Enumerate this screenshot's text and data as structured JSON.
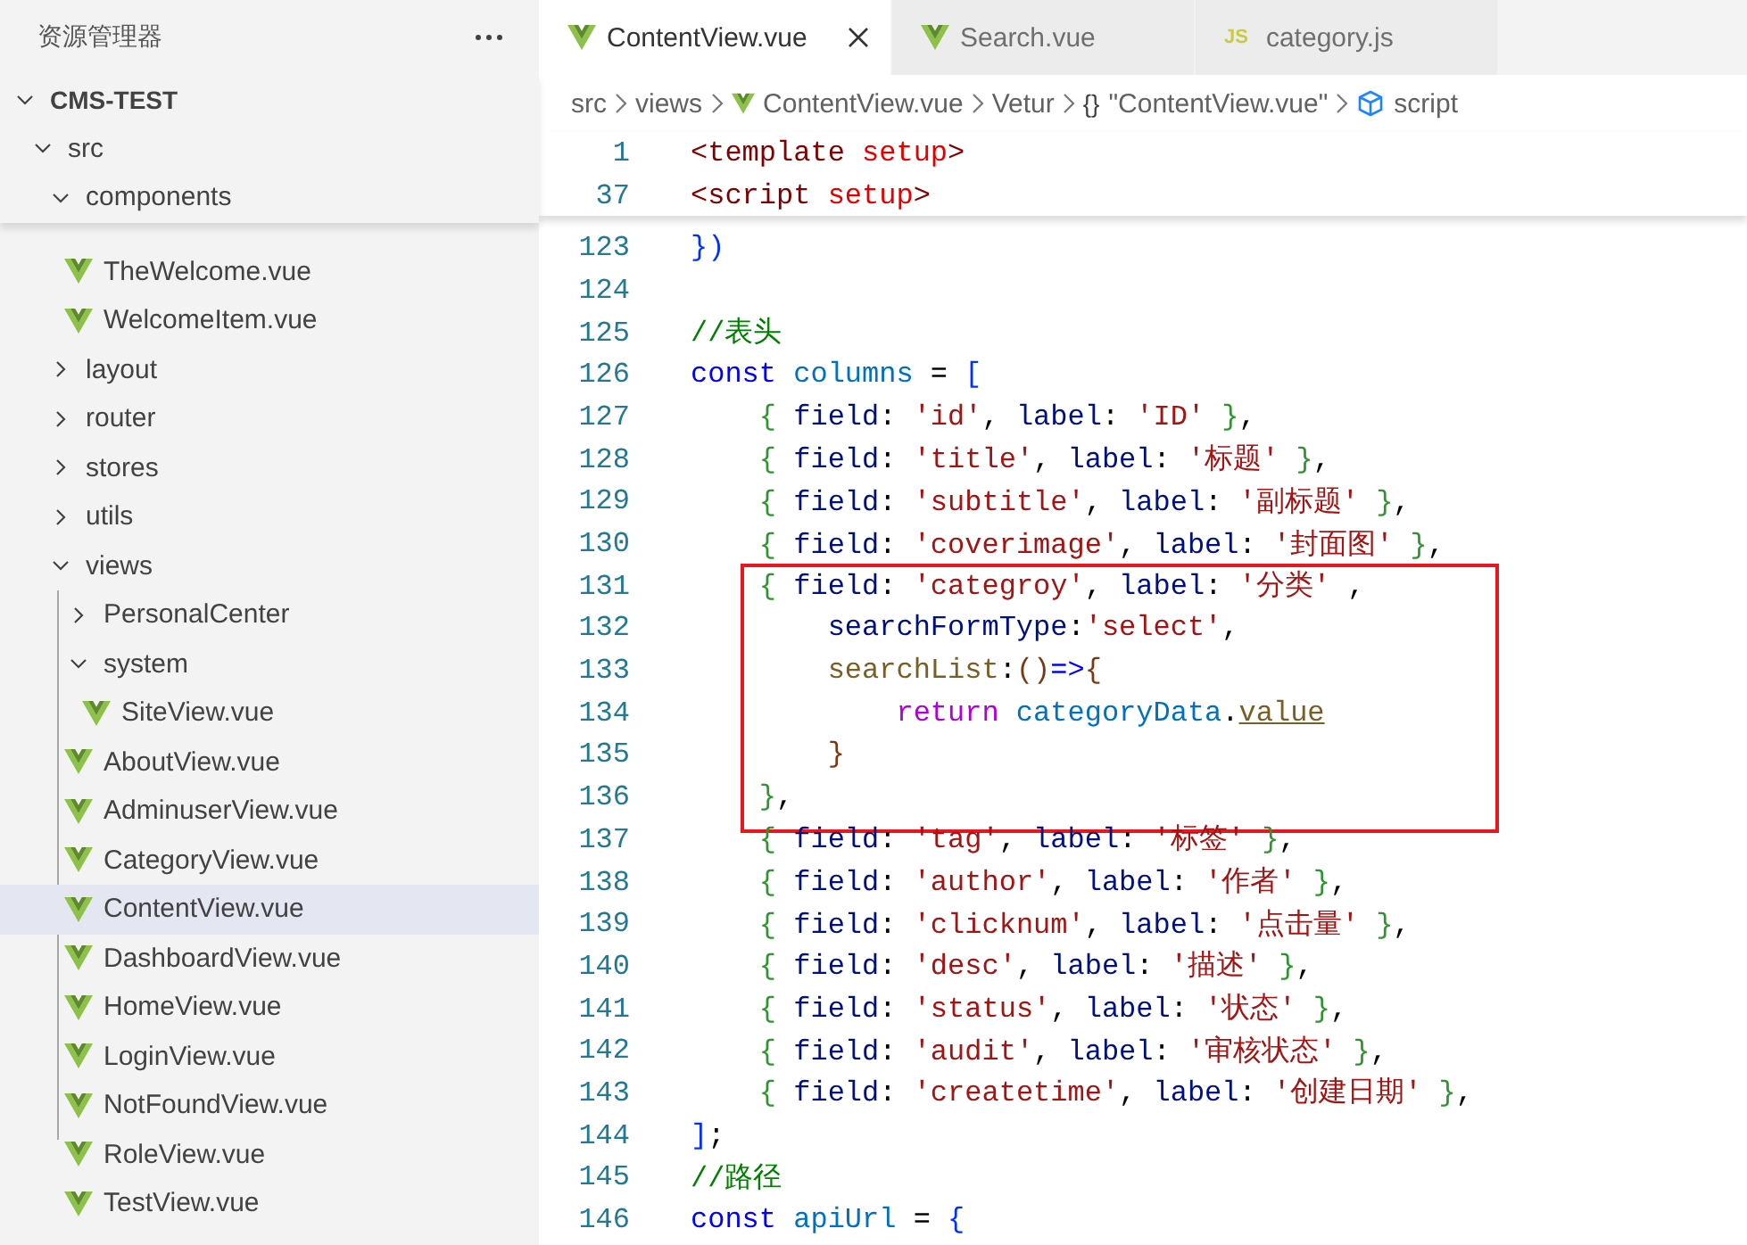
{
  "sidebar": {
    "title": "资源管理器",
    "tree": [
      {
        "name": "CMS-TEST",
        "kind": "folder",
        "expanded": true,
        "selected": false,
        "children": [
          {
            "name": "src",
            "kind": "folder",
            "expanded": true,
            "selected": false,
            "children": [
              {
                "name": "components",
                "kind": "folder",
                "expanded": true,
                "selected": false,
                "children": [
                  {
                    "name": "TheWelcome.vue",
                    "kind": "file",
                    "selected": false
                  },
                  {
                    "name": "WelcomeItem.vue",
                    "kind": "file",
                    "selected": false
                  }
                ]
              },
              {
                "name": "layout",
                "kind": "folder",
                "expanded": false,
                "selected": false
              },
              {
                "name": "router",
                "kind": "folder",
                "expanded": false,
                "selected": false
              },
              {
                "name": "stores",
                "kind": "folder",
                "expanded": false,
                "selected": false
              },
              {
                "name": "utils",
                "kind": "folder",
                "expanded": false,
                "selected": false
              },
              {
                "name": "views",
                "kind": "folder",
                "expanded": true,
                "selected": false,
                "children": [
                  {
                    "name": "PersonalCenter",
                    "kind": "folder",
                    "expanded": false,
                    "selected": false
                  },
                  {
                    "name": "system",
                    "kind": "folder",
                    "expanded": true,
                    "selected": false,
                    "children": [
                      {
                        "name": "SiteView.vue",
                        "kind": "file",
                        "selected": false
                      }
                    ]
                  },
                  {
                    "name": "AboutView.vue",
                    "kind": "file",
                    "selected": false
                  },
                  {
                    "name": "AdminuserView.vue",
                    "kind": "file",
                    "selected": false
                  },
                  {
                    "name": "CategoryView.vue",
                    "kind": "file",
                    "selected": false
                  },
                  {
                    "name": "ContentView.vue",
                    "kind": "file",
                    "selected": true
                  },
                  {
                    "name": "DashboardView.vue",
                    "kind": "file",
                    "selected": false
                  },
                  {
                    "name": "HomeView.vue",
                    "kind": "file",
                    "selected": false
                  },
                  {
                    "name": "LoginView.vue",
                    "kind": "file",
                    "selected": false
                  },
                  {
                    "name": "NotFoundView.vue",
                    "kind": "file",
                    "selected": false
                  },
                  {
                    "name": "RoleView.vue",
                    "kind": "file",
                    "selected": false
                  },
                  {
                    "name": "TestView.vue",
                    "kind": "file",
                    "selected": false
                  }
                ]
              }
            ]
          }
        ]
      }
    ]
  },
  "tabs": [
    {
      "label": "ContentView.vue",
      "kind": "vue",
      "selected": true
    },
    {
      "label": "Search.vue",
      "kind": "vue",
      "selected": false
    },
    {
      "label": "category.js",
      "kind": "js",
      "icon_text": "JS",
      "selected": false
    }
  ],
  "breadcrumb": [
    {
      "label": "src",
      "kind": "plain"
    },
    {
      "label": "views",
      "kind": "plain"
    },
    {
      "label": "ContentView.vue",
      "kind": "vue"
    },
    {
      "label": "Vetur",
      "kind": "plain"
    },
    {
      "label": "\"ContentView.vue\"",
      "kind": "object",
      "icon_text": "{}"
    },
    {
      "label": "script",
      "kind": "symbol"
    }
  ],
  "sticky_lines": [
    {
      "num": "1",
      "tokens": [
        {
          "t": "<template",
          "kind": "tag"
        },
        {
          "t": " setup",
          "kind": "attr"
        },
        {
          "t": ">",
          "kind": "tag"
        }
      ]
    },
    {
      "num": "37",
      "tokens": [
        {
          "t": "<script",
          "kind": "tag"
        },
        {
          "t": " setup",
          "kind": "attr"
        },
        {
          "t": ">",
          "kind": "tag"
        }
      ]
    }
  ],
  "sections": [
    {
      "boxed": false,
      "lines": [
        {
          "num": "123",
          "tokens": [
            {
              "t": "})",
              "kind": "b1"
            }
          ]
        },
        {
          "num": "124"
        },
        {
          "num": "125",
          "tokens": [
            {
              "t": "//表头",
              "kind": "comment"
            }
          ]
        },
        {
          "num": "126",
          "tokens": [
            {
              "t": "const",
              "kind": "kw"
            },
            {
              "t": " columns",
              "kind": "cls"
            },
            {
              "t": " = ",
              "kind": "punct"
            },
            {
              "t": "[",
              "kind": "b1"
            }
          ]
        },
        {
          "num": "127",
          "tokens": [
            {
              "t": "    {",
              "kind": "b2"
            },
            {
              "t": " field",
              "kind": "var"
            },
            {
              "t": ": ",
              "kind": "punct"
            },
            {
              "t": "'id'",
              "kind": "str"
            },
            {
              "t": ", ",
              "kind": "punct"
            },
            {
              "t": "label",
              "kind": "var"
            },
            {
              "t": ": ",
              "kind": "punct"
            },
            {
              "t": "'ID'",
              "kind": "str"
            },
            {
              "t": " }",
              "kind": "b2"
            },
            {
              "t": ",",
              "kind": "punct"
            }
          ]
        },
        {
          "num": "128",
          "tokens": [
            {
              "t": "    {",
              "kind": "b2"
            },
            {
              "t": " field",
              "kind": "var"
            },
            {
              "t": ": ",
              "kind": "punct"
            },
            {
              "t": "'title'",
              "kind": "str"
            },
            {
              "t": ", ",
              "kind": "punct"
            },
            {
              "t": "label",
              "kind": "var"
            },
            {
              "t": ": ",
              "kind": "punct"
            },
            {
              "t": "'标题'",
              "kind": "str"
            },
            {
              "t": " }",
              "kind": "b2"
            },
            {
              "t": ",",
              "kind": "punct"
            }
          ]
        },
        {
          "num": "129",
          "tokens": [
            {
              "t": "    {",
              "kind": "b2"
            },
            {
              "t": " field",
              "kind": "var"
            },
            {
              "t": ": ",
              "kind": "punct"
            },
            {
              "t": "'subtitle'",
              "kind": "str"
            },
            {
              "t": ", ",
              "kind": "punct"
            },
            {
              "t": "label",
              "kind": "var"
            },
            {
              "t": ": ",
              "kind": "punct"
            },
            {
              "t": "'副标题'",
              "kind": "str"
            },
            {
              "t": " }",
              "kind": "b2"
            },
            {
              "t": ",",
              "kind": "punct"
            }
          ]
        },
        {
          "num": "130",
          "tokens": [
            {
              "t": "    {",
              "kind": "b2"
            },
            {
              "t": " field",
              "kind": "var"
            },
            {
              "t": ": ",
              "kind": "punct"
            },
            {
              "t": "'coverimage'",
              "kind": "str"
            },
            {
              "t": ", ",
              "kind": "punct"
            },
            {
              "t": "label",
              "kind": "var"
            },
            {
              "t": ": ",
              "kind": "punct"
            },
            {
              "t": "'封面图'",
              "kind": "str"
            },
            {
              "t": " }",
              "kind": "b2"
            },
            {
              "t": ",",
              "kind": "punct"
            }
          ]
        }
      ]
    },
    {
      "boxed": true,
      "lines": [
        {
          "num": "131",
          "tokens": [
            {
              "t": "    {",
              "kind": "b2"
            },
            {
              "t": " field",
              "kind": "var"
            },
            {
              "t": ": ",
              "kind": "punct"
            },
            {
              "t": "'categroy'",
              "kind": "str"
            },
            {
              "t": ", ",
              "kind": "punct"
            },
            {
              "t": "label",
              "kind": "var"
            },
            {
              "t": ": ",
              "kind": "punct"
            },
            {
              "t": "'分类'",
              "kind": "str"
            },
            {
              "t": " ,",
              "kind": "punct"
            }
          ]
        },
        {
          "num": "132",
          "tokens": [
            {
              "t": "        searchFormType",
              "kind": "var"
            },
            {
              "t": ":",
              "kind": "punct"
            },
            {
              "t": "'select'",
              "kind": "str"
            },
            {
              "t": ",",
              "kind": "punct"
            }
          ]
        },
        {
          "num": "133",
          "tokens": [
            {
              "t": "        searchList",
              "kind": "fn"
            },
            {
              "t": ":",
              "kind": "punct"
            },
            {
              "t": "()",
              "kind": "b3"
            },
            {
              "t": "=>",
              "kind": "kw"
            },
            {
              "t": "{",
              "kind": "b3"
            }
          ]
        },
        {
          "num": "134",
          "tokens": [
            {
              "t": "            return",
              "kind": "ctrl"
            },
            {
              "t": " categoryData",
              "kind": "cls"
            },
            {
              "t": ".",
              "kind": "punct"
            },
            {
              "t": "value",
              "kind": "link"
            }
          ]
        },
        {
          "num": "135",
          "tokens": [
            {
              "t": "        }",
              "kind": "b3"
            }
          ]
        },
        {
          "num": "136",
          "tokens": [
            {
              "t": "    }",
              "kind": "b2"
            },
            {
              "t": ",",
              "kind": "punct"
            }
          ]
        }
      ]
    },
    {
      "boxed": false,
      "lines": [
        {
          "num": "137",
          "tokens": [
            {
              "t": "    {",
              "kind": "b2"
            },
            {
              "t": " field",
              "kind": "var"
            },
            {
              "t": ": ",
              "kind": "punct"
            },
            {
              "t": "'tag'",
              "kind": "str"
            },
            {
              "t": ", ",
              "kind": "punct"
            },
            {
              "t": "label",
              "kind": "var"
            },
            {
              "t": ": ",
              "kind": "punct"
            },
            {
              "t": "'标签'",
              "kind": "str"
            },
            {
              "t": " }",
              "kind": "b2"
            },
            {
              "t": ",",
              "kind": "punct"
            }
          ]
        },
        {
          "num": "138",
          "tokens": [
            {
              "t": "    {",
              "kind": "b2"
            },
            {
              "t": " field",
              "kind": "var"
            },
            {
              "t": ": ",
              "kind": "punct"
            },
            {
              "t": "'author'",
              "kind": "str"
            },
            {
              "t": ", ",
              "kind": "punct"
            },
            {
              "t": "label",
              "kind": "var"
            },
            {
              "t": ": ",
              "kind": "punct"
            },
            {
              "t": "'作者'",
              "kind": "str"
            },
            {
              "t": " }",
              "kind": "b2"
            },
            {
              "t": ",",
              "kind": "punct"
            }
          ]
        },
        {
          "num": "139",
          "tokens": [
            {
              "t": "    {",
              "kind": "b2"
            },
            {
              "t": " field",
              "kind": "var"
            },
            {
              "t": ": ",
              "kind": "punct"
            },
            {
              "t": "'clicknum'",
              "kind": "str"
            },
            {
              "t": ", ",
              "kind": "punct"
            },
            {
              "t": "label",
              "kind": "var"
            },
            {
              "t": ": ",
              "kind": "punct"
            },
            {
              "t": "'点击量'",
              "kind": "str"
            },
            {
              "t": " }",
              "kind": "b2"
            },
            {
              "t": ",",
              "kind": "punct"
            }
          ]
        },
        {
          "num": "140",
          "tokens": [
            {
              "t": "    {",
              "kind": "b2"
            },
            {
              "t": " field",
              "kind": "var"
            },
            {
              "t": ": ",
              "kind": "punct"
            },
            {
              "t": "'desc'",
              "kind": "str"
            },
            {
              "t": ", ",
              "kind": "punct"
            },
            {
              "t": "label",
              "kind": "var"
            },
            {
              "t": ": ",
              "kind": "punct"
            },
            {
              "t": "'描述'",
              "kind": "str"
            },
            {
              "t": " }",
              "kind": "b2"
            },
            {
              "t": ",",
              "kind": "punct"
            }
          ]
        },
        {
          "num": "141",
          "tokens": [
            {
              "t": "    {",
              "kind": "b2"
            },
            {
              "t": " field",
              "kind": "var"
            },
            {
              "t": ": ",
              "kind": "punct"
            },
            {
              "t": "'status'",
              "kind": "str"
            },
            {
              "t": ", ",
              "kind": "punct"
            },
            {
              "t": "label",
              "kind": "var"
            },
            {
              "t": ": ",
              "kind": "punct"
            },
            {
              "t": "'状态'",
              "kind": "str"
            },
            {
              "t": " }",
              "kind": "b2"
            },
            {
              "t": ",",
              "kind": "punct"
            }
          ]
        },
        {
          "num": "142",
          "tokens": [
            {
              "t": "    {",
              "kind": "b2"
            },
            {
              "t": " field",
              "kind": "var"
            },
            {
              "t": ": ",
              "kind": "punct"
            },
            {
              "t": "'audit'",
              "kind": "str"
            },
            {
              "t": ", ",
              "kind": "punct"
            },
            {
              "t": "label",
              "kind": "var"
            },
            {
              "t": ": ",
              "kind": "punct"
            },
            {
              "t": "'审核状态'",
              "kind": "str"
            },
            {
              "t": " }",
              "kind": "b2"
            },
            {
              "t": ",",
              "kind": "punct"
            }
          ]
        },
        {
          "num": "143",
          "tokens": [
            {
              "t": "    {",
              "kind": "b2"
            },
            {
              "t": " field",
              "kind": "var"
            },
            {
              "t": ": ",
              "kind": "punct"
            },
            {
              "t": "'createtime'",
              "kind": "str"
            },
            {
              "t": ", ",
              "kind": "punct"
            },
            {
              "t": "label",
              "kind": "var"
            },
            {
              "t": ": ",
              "kind": "punct"
            },
            {
              "t": "'创建日期'",
              "kind": "str"
            },
            {
              "t": " }",
              "kind": "b2"
            },
            {
              "t": ",",
              "kind": "punct"
            }
          ]
        },
        {
          "num": "144",
          "tokens": [
            {
              "t": "]",
              "kind": "b1"
            },
            {
              "t": ";",
              "kind": "punct"
            }
          ]
        },
        {
          "num": "145",
          "tokens": [
            {
              "t": "//路径",
              "kind": "comment"
            }
          ]
        },
        {
          "num": "146",
          "tokens": [
            {
              "t": "const",
              "kind": "kw"
            },
            {
              "t": " apiUrl",
              "kind": "cls"
            },
            {
              "t": " = ",
              "kind": "punct"
            },
            {
              "t": "{",
              "kind": "b1"
            }
          ]
        }
      ]
    }
  ]
}
